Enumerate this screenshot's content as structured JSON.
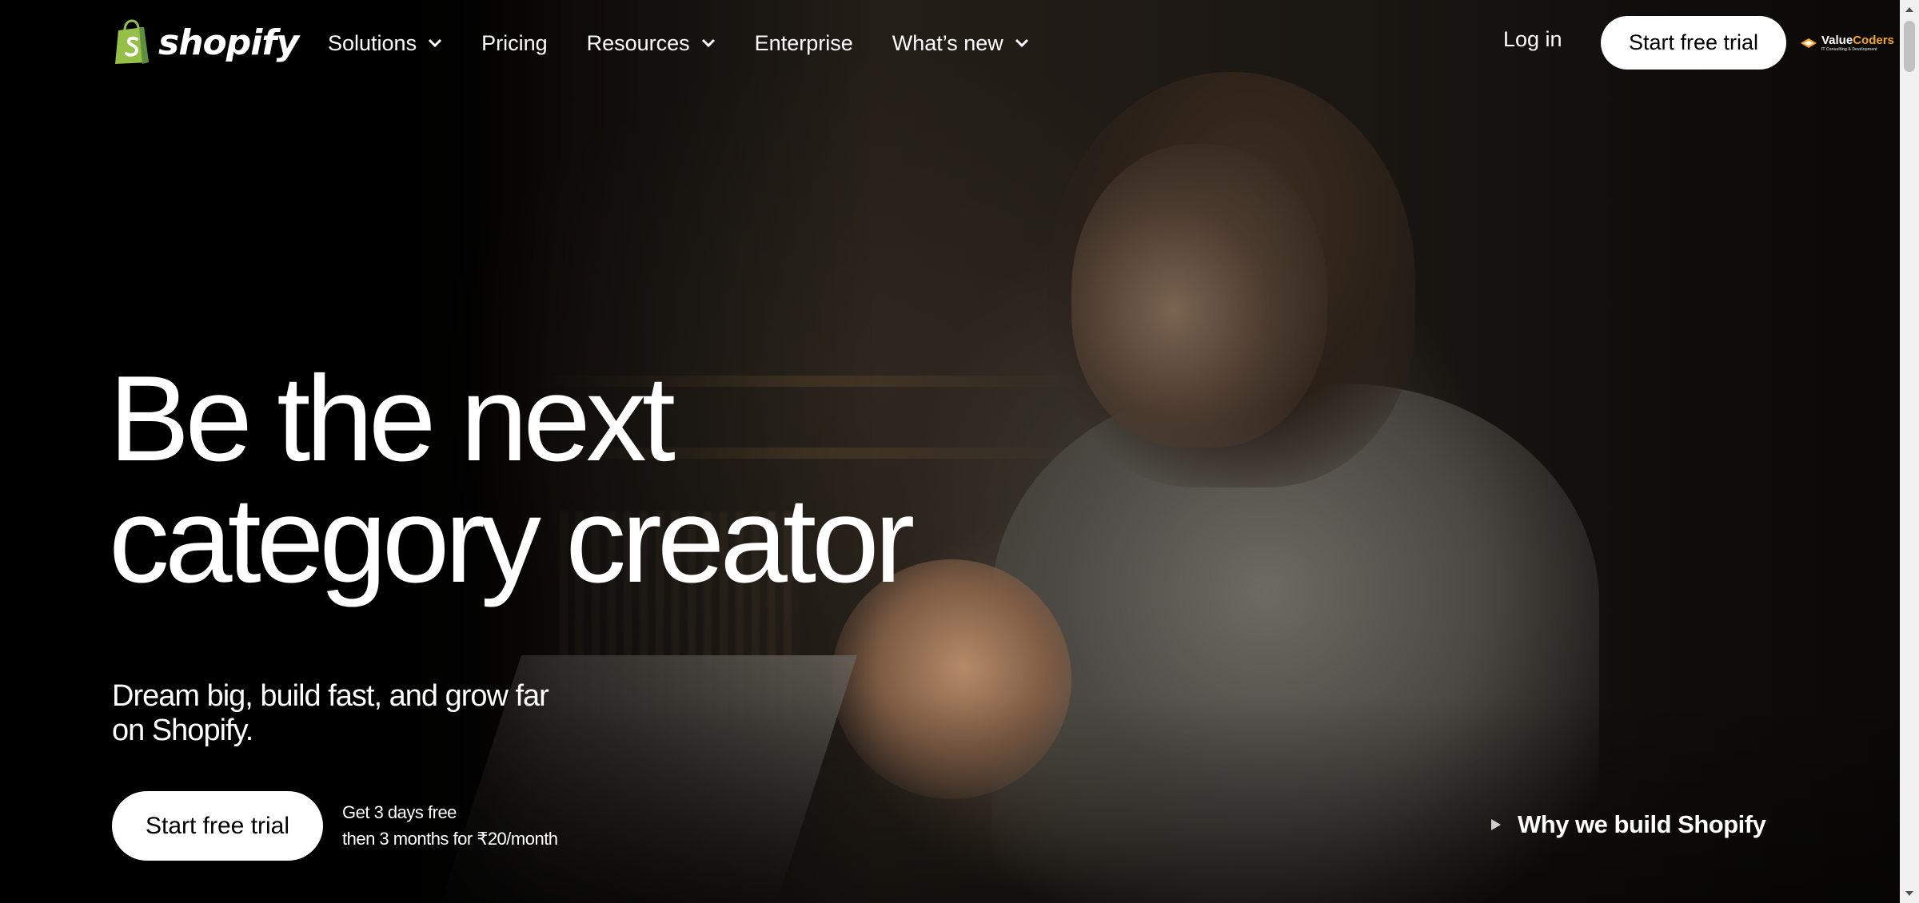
{
  "header": {
    "logo_text": "shopify",
    "nav": [
      {
        "label": "Solutions",
        "has_dropdown": true
      },
      {
        "label": "Pricing",
        "has_dropdown": false
      },
      {
        "label": "Resources",
        "has_dropdown": true
      },
      {
        "label": "Enterprise",
        "has_dropdown": false
      },
      {
        "label": "What’s new",
        "has_dropdown": true
      }
    ],
    "login_label": "Log in",
    "trial_label": "Start free trial",
    "partner_logo": {
      "part1": "Value",
      "part2": "Coders",
      "tagline": "IT Consulting & Development"
    }
  },
  "hero": {
    "headline_line1": "Be the next",
    "headline_line2": "category creator",
    "subhead": "Dream big, build fast, and grow far on Shopify.",
    "cta_label": "Start free trial",
    "offer_line1": "Get 3 days free",
    "offer_line2": "then 3 months for ₹20/month",
    "video_label": "Why we build Shopify"
  },
  "colors": {
    "brand_green": "#95bf47",
    "brand_green_dark": "#5e8e3e",
    "partner_orange": "#f5a623",
    "background": "#000000",
    "button_bg": "#ffffff"
  },
  "icons": [
    "shopify-bag-icon",
    "chevron-down-icon",
    "play-icon",
    "valuecoders-icon",
    "scroll-up-icon",
    "scroll-down-icon"
  ]
}
